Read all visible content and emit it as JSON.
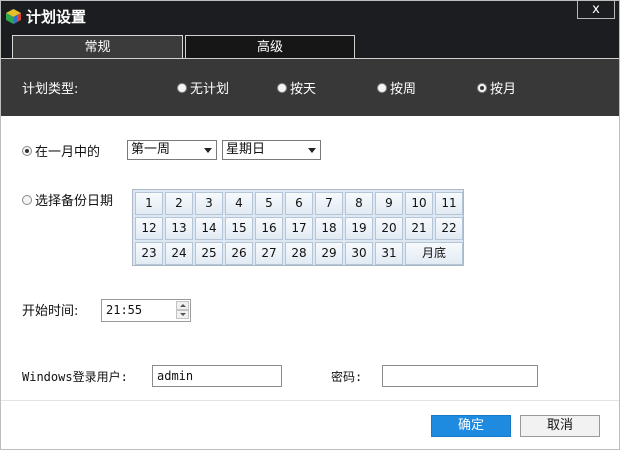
{
  "window": {
    "title": "计划设置",
    "close_label": "x"
  },
  "tabs": [
    {
      "label": "常规",
      "active": true
    },
    {
      "label": "高级",
      "active": false
    }
  ],
  "plan_type": {
    "label": "计划类型:",
    "options": [
      {
        "label": "无计划",
        "checked": false
      },
      {
        "label": "按天",
        "checked": false
      },
      {
        "label": "按周",
        "checked": false
      },
      {
        "label": "按月",
        "checked": true
      }
    ]
  },
  "in_month": {
    "label": "在一月中的",
    "checked": true,
    "week_select": "第一周",
    "day_select": "星期日"
  },
  "backup_date": {
    "label": "选择备份日期",
    "checked": false,
    "days": [
      "1",
      "2",
      "3",
      "4",
      "5",
      "6",
      "7",
      "8",
      "9",
      "10",
      "11",
      "12",
      "13",
      "14",
      "15",
      "16",
      "17",
      "18",
      "19",
      "20",
      "21",
      "22",
      "23",
      "24",
      "25",
      "26",
      "27",
      "28",
      "29",
      "30",
      "31"
    ],
    "month_end": "月底"
  },
  "start_time": {
    "label": "开始时间:",
    "value": "21:55"
  },
  "credentials": {
    "user_label": "Windows登录用户:",
    "user_value": "admin",
    "password_label": "密码:",
    "password_value": ""
  },
  "footer": {
    "ok": "确定",
    "cancel": "取消"
  },
  "colors": {
    "titlebar": "#1c1d20",
    "panel": "#383838",
    "primary_button": "#1e8be1"
  }
}
